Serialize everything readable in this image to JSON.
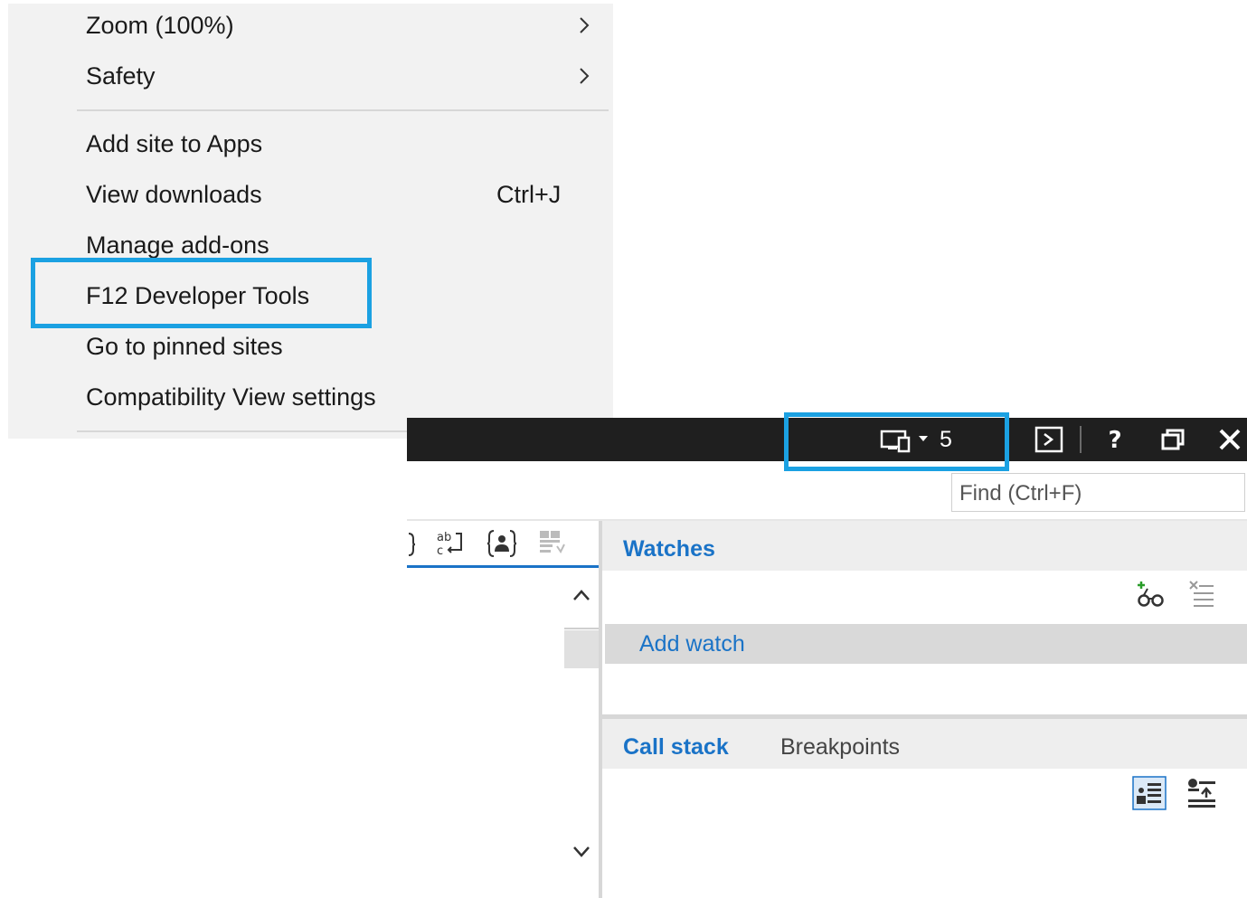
{
  "menu": {
    "items": [
      {
        "label": "Zoom (100%)",
        "submenu": true
      },
      {
        "label": "Safety",
        "submenu": true
      },
      {
        "label": "Add site to Apps"
      },
      {
        "label": "View downloads",
        "shortcut": "Ctrl+J"
      },
      {
        "label": "Manage add-ons"
      },
      {
        "label": "F12 Developer Tools",
        "highlighted": true
      },
      {
        "label": "Go to pinned sites"
      },
      {
        "label": "Compatibility View settings"
      }
    ]
  },
  "devtools": {
    "emulation_target_count": "5",
    "find_placeholder": "Find (Ctrl+F)",
    "watches": {
      "title": "Watches",
      "add_watch_label": "Add watch"
    },
    "bottom_tabs": {
      "call_stack": "Call stack",
      "breakpoints": "Breakpoints"
    }
  },
  "colors": {
    "highlight_border": "#1ba1e2",
    "title_bar": "#1f1f1f",
    "accent_blue": "#1a73c7",
    "menu_background": "#f2f2f2"
  }
}
